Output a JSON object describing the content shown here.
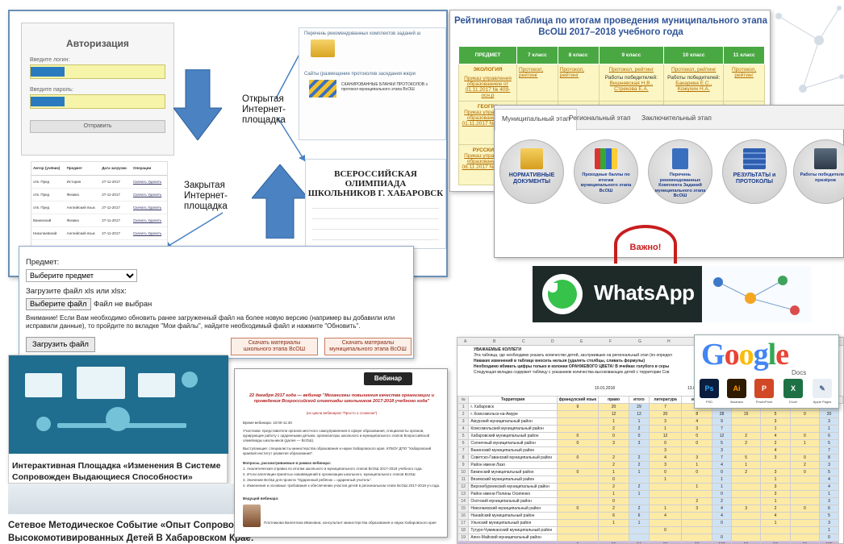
{
  "scheme": {
    "auth_title": "Авторизация",
    "login_label": "Введите логин:",
    "password_label": "Введите пароль:",
    "submit_label": "Отправить",
    "open_label_1": "Открытая",
    "open_label_2": "Интернет-",
    "open_label_3": "площадка",
    "closed_label_1": "Закрытая",
    "closed_label_2": "Интернет-",
    "closed_label_3": "площадка",
    "doc_item_1": "Перечень рекомендованных комплектов заданий ш",
    "doc_item_2": "Сайты (размещение протоколов заседания жюри",
    "doc_desc_2": "СКАНИРОВАННЫЕ БЛАНКИ ПРОТОКОЛОВ з протокол муниципального этапа ВсОШ",
    "olymp_title_1": "ВСЕРОССИЙСКАЯ ОЛИМПИАДА",
    "olymp_title_2": "ШКОЛЬНИКОВ Г. ХАБАРОВСК",
    "table_head": [
      "Автор (учёник)",
      "Предмет",
      "Дата загрузки",
      "Операции"
    ],
    "table_rows": [
      [
        "отв. Пред",
        "История",
        "27-11-2017",
        "Скачать Удалить"
      ],
      [
        "отв. Пред",
        "Физика",
        "27-11-2017",
        "Скачать Удалить"
      ],
      [
        "отв. Пред",
        "Английский язык",
        "27-11-2017",
        "Скачать Удалить"
      ],
      [
        "Ванинский",
        "Физика",
        "27-11-2017",
        "Скачать Удалить"
      ],
      [
        "Николаевский",
        "Английский язык",
        "27-11-2017",
        "Скачать Удалить"
      ]
    ]
  },
  "upload": {
    "subject_label": "Предмет:",
    "subject_value": "Выберите предмет",
    "file_label": "Загрузите файл xls или xlsx:",
    "file_button": "Выберите файл",
    "file_status": "Файл не выбран",
    "warning": "Внимание! Если Вам необходимо обновить ранее загруженный файл на более новую версию (например вы добавили или исправили данные), то пройдите по вкладке \"Мои файлы\", найдите необходимый файл и нажмите \"Обновить\".",
    "upload_button": "Загрузить файл",
    "dl_school_1": "Скачать материалы",
    "dl_school_2": "школьного этапа ВсОШ",
    "dl_muni_1": "Скачать материалы",
    "dl_muni_2": "муниципального этапа ВсОШ"
  },
  "platform": {
    "caption": "Интерактивная Площадка «Изменения В Системе Сопровожден Выдающиеся Способности»"
  },
  "seti": {
    "caption": "Сетевое Методическое Событие «Опыт Сопровождения С Высокомотивированных Детей В Хабаровском Крае: Открытая Плоц"
  },
  "webinar": {
    "badge": "Вебинар",
    "title": "22 декабря 2017 года — вебинар \"Механизмы повышения качества организации и проведения Всероссийской олимпиады школьников 2017-2018 учебного года\"",
    "subtitle": "(из цикла вебинаров \"Просто о сложном\")",
    "time": "Время вебинара: 10:00-11:30",
    "participants": "Участники: представители органов местного самоуправления в сфере образования, специалисты органов, курирующие работу с одаренными детьми, организаторы школьного и муниципального этапов Всероссийской олимпиады школьников (далее — ВсОШ).",
    "speakers": "Выступающие: специалисты министерства образования и науки Хабаровского края, КГБОУ ДПО \"Хабаровский краевой институт развития образования\".",
    "questions_title": "Вопросы, рассматриваемые в рамках вебинара:",
    "q1": "1. Аналитическая справка по итогам школьного и муниципального этапов ВсОШ 2017-2018 учебного года.",
    "q2": "2. Итоги апелляции принятых нововведений в организации школьного, муниципального этапов ВсОШ.",
    "q3": "3. Значение ВсОШ для проекта \"Одаренный ребёнок = одаренный учитель\".",
    "q4": "4. Изменения и основные требования к обеспечению участия детей в региональном этапе ВсОШ 2017-2018 уч.года.",
    "leader_label": "Ведущий вебинара:",
    "leader_name": "Плотникова Валентина Ивановна, консультант министерства образования и науки Хабаровского края"
  },
  "rating": {
    "title_1": "Рейтинговая таблица по итогам проведения муниципального этапа",
    "title_2": "ВсОШ 2017–2018 учебного года",
    "headers": [
      "ПРЕДМЕТ",
      "7 класс",
      "8 класс",
      "9 класс",
      "10 класс",
      "11 класс"
    ],
    "row1": {
      "subject": "ЭКОЛОГИЯ",
      "order": "Приказ управления образованием от 01.11.2017 № 409-осн.р",
      "c7": "Протокол, рейтинг",
      "c8": "Протокол, рейтинг",
      "c9_a": "Протокол, рейтинг",
      "c9_b": "Работы победителей:",
      "c9_c": "Вишневская Н.В., Стрекова Е.А.",
      "c10_a": "Протокол, рейтинг",
      "c10_b": "Работы победителей:",
      "c10_c": "Бакарева Е.С., Кожухин Н.А.",
      "c11": "Протокол, рейтинг"
    },
    "row2": {
      "subject": "ГЕОГРА",
      "order": "Приказ управления образованием от 01.11.2017 № ...осн.р"
    },
    "row3": {
      "subject": "РУССКИЙ Я",
      "order": "Приказ управления образованием от 08.11.2017 № ...осн.р"
    }
  },
  "stages": {
    "tabs": [
      "Муниципальный этап",
      "Региональный этап",
      "Заключительный этап"
    ],
    "cards": [
      "НОРМАТИВНЫЕ ДОКУМЕНТЫ",
      "Проходные баллы по итогам муниципального этапа ВсОШ",
      "Перечень рекомендованных Комплекта Заданий муниципального этапа ВсОШ",
      "РЕЗУЛЬТАТЫ и ПРОТОКОЛЫ",
      "Работы победителей и призёров"
    ],
    "important": "Важно!"
  },
  "whatsapp": {
    "text": "WhatsApp"
  },
  "sheet": {
    "cols": [
      "A",
      "B",
      "C",
      "D",
      "E",
      "F",
      "G",
      "H",
      "I",
      "J",
      "K",
      "L",
      "M"
    ],
    "notice_1": "УВАЖАЕМЫЕ КОЛЛЕГИ",
    "notice_2": "Эта таблица, где необходимо указать количество детей, заслуживших на региональный этап (по определ",
    "notice_3": "Никаких изменений в таблице вносить нельзя (удалять столбцы, сливать формулы)",
    "notice_4": "Необходимо вбивать цифры только в колонки ОРАНЖЕВОГО ЦВЕТА! В ячейках голубого в серы",
    "notice_5": "Следующая вкладка содержит таблицу с указанием количества высоковающих детей с территории Сов",
    "date_1": "10.01.2018",
    "date_2": "13.0",
    "header": [
      "Территория",
      "французский язык",
      "право",
      "итого",
      "литература",
      "итого",
      "",
      "",
      "",
      "",
      "",
      ""
    ],
    "rows": [
      [
        "1",
        "г. Хабаровск",
        "9",
        "20",
        "29",
        "7",
        "",
        "",
        "",
        "",
        "",
        ""
      ],
      [
        "2",
        "г. Комсомольск-на-Амуре",
        "",
        "12",
        "12",
        "20",
        "8",
        "28",
        "15",
        "5",
        "0",
        "20"
      ],
      [
        "3",
        "Амурский муниципальный район",
        "",
        "1",
        "1",
        "3",
        "4",
        "9",
        "",
        "3",
        "",
        "3"
      ],
      [
        "4",
        "Комсомольский муниципальный район",
        "",
        "2",
        "2",
        "1",
        "3",
        "7",
        "",
        "1",
        "",
        "1"
      ],
      [
        "5",
        "Хабаровский муниципальный район",
        "0",
        "0",
        "0",
        "12",
        "0",
        "12",
        "2",
        "4",
        "0",
        "6"
      ],
      [
        "6",
        "Солнечный муниципальный район",
        "0",
        "3",
        "3",
        "0",
        "0",
        "5",
        "2",
        "2",
        "1",
        "5"
      ],
      [
        "7",
        "Ванинский муниципальный район",
        "",
        "",
        "",
        "3",
        "",
        "3",
        "",
        "4",
        "",
        "7"
      ],
      [
        "8",
        "Советско-Гаванский муниципальный район",
        "0",
        "2",
        "2",
        "4",
        "3",
        "7",
        "5",
        "3",
        "0",
        "8"
      ],
      [
        "9",
        "Район имени Лазо",
        "",
        "2",
        "2",
        "3",
        "1",
        "4",
        "1",
        "",
        "2",
        "3"
      ],
      [
        "10",
        "Бикинский муниципальный район",
        "0",
        "1",
        "1",
        "0",
        "0",
        "0",
        "2",
        "3",
        "0",
        "5"
      ],
      [
        "11",
        "Вяземский муниципальный район",
        "",
        "0",
        "",
        "1",
        "",
        "1",
        "",
        "1",
        "",
        "4"
      ],
      [
        "12",
        "Верхнебуреинский муниципальный район",
        "",
        "2",
        "2",
        "",
        "1",
        "1",
        "",
        "3",
        "",
        "4"
      ],
      [
        "13",
        "Район имени Полины Осипенко",
        "",
        "1",
        "1",
        "",
        "",
        "0",
        "",
        "3",
        "",
        "1"
      ],
      [
        "14",
        "Охотский муниципальный район",
        "",
        "0",
        "",
        "",
        "2",
        "2",
        "",
        "1",
        "",
        "3"
      ],
      [
        "15",
        "Николаевский муниципальный район",
        "0",
        "2",
        "2",
        "1",
        "3",
        "4",
        "3",
        "2",
        "0",
        "6"
      ],
      [
        "16",
        "Нанайский муниципальный район",
        "",
        "6",
        "6",
        "4",
        "",
        "4",
        "",
        "4",
        "",
        "5"
      ],
      [
        "17",
        "Ульчский муниципальный район",
        "",
        "1",
        "1",
        "",
        "",
        "0",
        "",
        "1",
        "",
        "3"
      ],
      [
        "18",
        "Тугуро-Чумиканский муниципальный район",
        "",
        "",
        "",
        "0",
        "",
        "",
        "",
        "",
        "",
        "1"
      ],
      [
        "19",
        "Аяно-Майский муниципальный район",
        "",
        "",
        "",
        "",
        "",
        "0",
        "",
        "",
        "",
        "0"
      ],
      [
        "",
        "итого",
        "9",
        "55",
        "64",
        "69",
        "33",
        "102",
        "63",
        "57",
        "15",
        "135"
      ]
    ]
  },
  "google": {
    "word": "Google",
    "docs": "Docs",
    "apps": [
      "PSD",
      "Illustrator",
      "PowerPoint",
      "Excel",
      "Apple Pages"
    ],
    "apps_short": [
      "Ps",
      "Ai",
      "P",
      "X",
      "✎"
    ]
  },
  "colors": {
    "rating_title": "#2f5496",
    "rating_header": "#4aa843",
    "whatsapp_green": "#36c24b",
    "google": [
      "#4285f4",
      "#ea4335",
      "#fbbc05",
      "#4285f4",
      "#34a853",
      "#ea4335"
    ]
  }
}
